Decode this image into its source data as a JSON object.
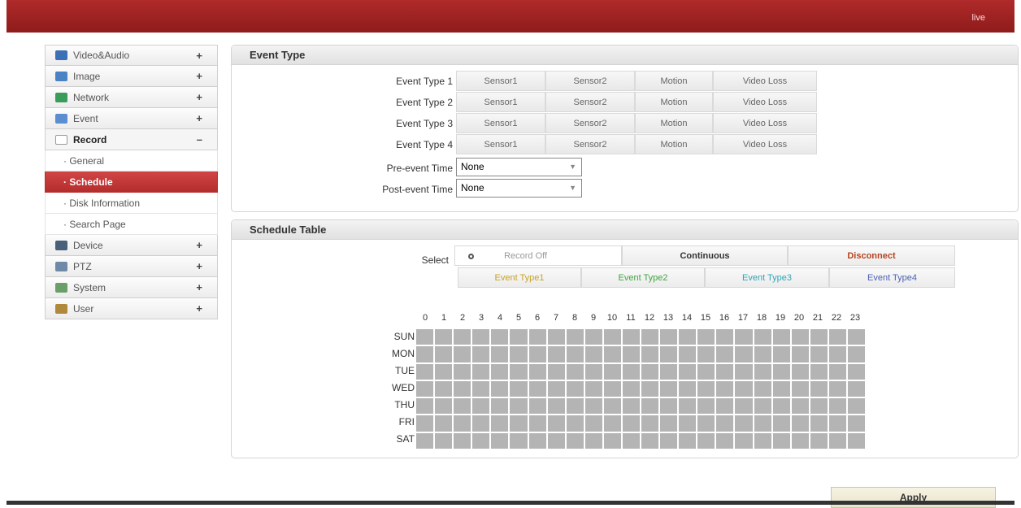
{
  "header": {
    "live_label": "live"
  },
  "sidebar": {
    "items": [
      {
        "label": "Video&Audio",
        "sign": "+",
        "icon_color": "#3c6fb5"
      },
      {
        "label": "Image",
        "sign": "+",
        "icon_color": "#4a83c4"
      },
      {
        "label": "Network",
        "sign": "+",
        "icon_color": "#3a9c5a"
      },
      {
        "label": "Event",
        "sign": "+",
        "icon_color": "#5b8ed0"
      },
      {
        "label": "Record",
        "sign": "–",
        "icon_color": "#8a8a8a"
      }
    ],
    "record_sub": [
      {
        "label": "· General"
      },
      {
        "label": "· Schedule"
      },
      {
        "label": "· Disk Information"
      },
      {
        "label": "· Search Page"
      }
    ],
    "items_after": [
      {
        "label": "Device",
        "sign": "+",
        "icon_color": "#4a5f7a"
      },
      {
        "label": "PTZ",
        "sign": "+",
        "icon_color": "#6f8aa8"
      },
      {
        "label": "System",
        "sign": "+",
        "icon_color": "#6a9f6a"
      },
      {
        "label": "User",
        "sign": "+",
        "icon_color": "#b08a3c"
      }
    ]
  },
  "event_panel": {
    "title": "Event Type",
    "rows": [
      {
        "label": "Event Type 1",
        "buttons": [
          "Sensor1",
          "Sensor2",
          "Motion",
          "Video Loss"
        ]
      },
      {
        "label": "Event Type 2",
        "buttons": [
          "Sensor1",
          "Sensor2",
          "Motion",
          "Video Loss"
        ]
      },
      {
        "label": "Event Type 3",
        "buttons": [
          "Sensor1",
          "Sensor2",
          "Motion",
          "Video Loss"
        ]
      },
      {
        "label": "Event Type 4",
        "buttons": [
          "Sensor1",
          "Sensor2",
          "Motion",
          "Video Loss"
        ]
      }
    ],
    "pre_event": {
      "label": "Pre-event Time",
      "value": "None"
    },
    "post_event": {
      "label": "Post-event Time",
      "value": "None"
    }
  },
  "schedule_panel": {
    "title": "Schedule Table",
    "select_label": "Select",
    "record_off": "Record Off",
    "continuous": "Continuous",
    "disconnect": "Disconnect",
    "event_types": [
      {
        "label": "Event Type1",
        "color": "#c9a227"
      },
      {
        "label": "Event Type2",
        "color": "#3fa63f"
      },
      {
        "label": "Event Type3",
        "color": "#2fa6b6"
      },
      {
        "label": "Event Type4",
        "color": "#4a62b5"
      }
    ],
    "hours": [
      "0",
      "1",
      "2",
      "3",
      "4",
      "5",
      "6",
      "7",
      "8",
      "9",
      "10",
      "11",
      "12",
      "13",
      "14",
      "15",
      "16",
      "17",
      "18",
      "19",
      "20",
      "21",
      "22",
      "23"
    ],
    "days": [
      "SUN",
      "MON",
      "TUE",
      "WED",
      "THU",
      "FRI",
      "SAT"
    ]
  },
  "apply_label": "Apply",
  "colors": {
    "header": "#a32525",
    "active": "#c43a3a",
    "disconnect": "#b5431f",
    "cell": "#b4b4b4"
  }
}
